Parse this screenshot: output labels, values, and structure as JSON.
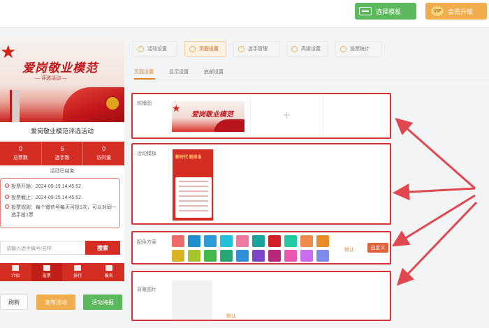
{
  "toolbar": {
    "template_label": "选择模板",
    "vip_badge": "VIP",
    "vip_label": "会员升级"
  },
  "preview": {
    "banner_title": "爱岗敬业模范",
    "banner_sub": "— 评选活动 —",
    "event_name": "爱岗敬业模范评选活动",
    "stats": [
      {
        "value": "0",
        "label": "总票数"
      },
      {
        "value": "6",
        "label": "选手数"
      },
      {
        "value": "0",
        "label": "访问量"
      }
    ],
    "status": "活动已结束",
    "vote_start": "投票开始：2024-09-19 14:45:52",
    "vote_end": "投票截止：2024-09-25 14:45:52",
    "vote_rule": "投票规则：每个微信号每天可投1次，可以对同一选手投1票",
    "search_placeholder": "请输入选手编号/名称",
    "search_button": "搜索",
    "nav": [
      "介绍",
      "投票",
      "排行",
      "报名"
    ],
    "refresh": "刷新",
    "publish": "发布活动",
    "poster": "活动海报"
  },
  "settings": {
    "tabs": [
      "活动设置",
      "页面设置",
      "选手管理",
      "高级设置",
      "投票统计"
    ],
    "subtabs": [
      "页面设置",
      "显示设置",
      "底部设置"
    ],
    "carousel_label": "轮播图",
    "carousel_thumb_title": "爱岗敬业模范",
    "template_label": "活动模板",
    "template_thumb_title": "新时代 新担当",
    "color_label": "配色方案",
    "color_default": "默认",
    "color_custom": "自定义",
    "bg_label": "背景图片",
    "bg_default": "默认",
    "swatches": [
      "#f06a6a",
      "#1f8fd1",
      "#2f9bd6",
      "#23c1d8",
      "#ee7aa0",
      "#1aa39a",
      "#d11f25",
      "#27c7a0",
      "#f08a4c",
      "#e98d27",
      "#d9b321",
      "#a6c52a",
      "#45b84a",
      "#25a873",
      "#2f8fd8",
      "#7b49c8",
      "#b8287a",
      "#ea56b0",
      "#c96cf0",
      "#7f8be8"
    ]
  },
  "colors": {
    "accent": "#d42d24",
    "highlight_border": "#d6323a",
    "orange": "#e0862c"
  }
}
